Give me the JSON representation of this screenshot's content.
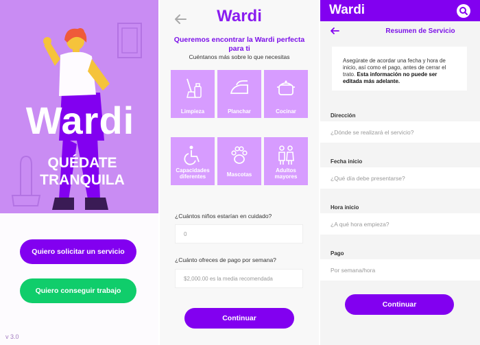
{
  "colors": {
    "brand_purple": "#8200f0",
    "hero_purple": "#c98cf3",
    "tile_purple": "#d79cff",
    "green": "#10cd6b"
  },
  "welcome": {
    "logo": "Wardi",
    "tagline_line1": "QUÉDATE",
    "tagline_line2": "TRANQUILA",
    "request_service_button": "Quiero solicitar un servicio",
    "get_job_button": "Quiero conseguir trabajo",
    "version": "v 3.0"
  },
  "preferences": {
    "logo": "Wardi",
    "title": "Queremos encontrar la Wardi perfecta para ti",
    "subtitle": "Cuéntanos más sobre lo que necesitas",
    "tiles": [
      {
        "label": "Limpieza",
        "icon": "cleaning-icon"
      },
      {
        "label": "Planchar",
        "icon": "iron-icon"
      },
      {
        "label": "Cocinar",
        "icon": "cooking-pot-icon"
      },
      {
        "label": "Capacidades diferentes",
        "icon": "wheelchair-icon"
      },
      {
        "label": "Mascotas",
        "icon": "paw-icon"
      },
      {
        "label": "Adultos mayores",
        "icon": "elderly-icon"
      }
    ],
    "children_question": "¿Cuántos niños estarían en cuidado?",
    "children_value": "0",
    "payment_question": "¿Cuánto ofreces de pago por semana?",
    "payment_placeholder": "$2,000.00 es la media recomendada",
    "continue_button": "Continuar"
  },
  "summary": {
    "logo": "Wardi",
    "title": "Resumen de Servicio",
    "note_text": "Asegúrate de acordar una fecha y hora de inicio, así como el pago, antes de cerrar el trato.",
    "note_bold": "Esta información no puede ser editada más adelante.",
    "fields": [
      {
        "label": "Dirección",
        "placeholder": "¿Dónde se realizará el servicio?"
      },
      {
        "label": "Fecha inicio",
        "placeholder": "¿Qué día debe presentarse?"
      },
      {
        "label": "Hora inicio",
        "placeholder": "¿A qué hora empieza?"
      },
      {
        "label": "Pago",
        "placeholder": "Por semana/hora"
      }
    ],
    "continue_button": "Continuar"
  }
}
